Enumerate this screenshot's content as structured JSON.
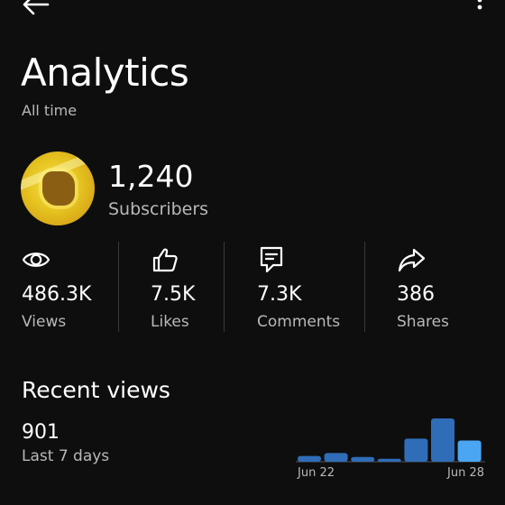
{
  "header": {
    "title": "Analytics",
    "period": "All time"
  },
  "channel": {
    "subscriber_count": "1,240",
    "subscriber_label": "Subscribers"
  },
  "stats": [
    {
      "value": "486.3K",
      "label": "Views"
    },
    {
      "value": "7.5K",
      "label": "Likes"
    },
    {
      "value": "7.3K",
      "label": "Comments"
    },
    {
      "value": "386",
      "label": "Shares"
    }
  ],
  "recent": {
    "title": "Recent views",
    "value": "901",
    "period_label": "Last 7 days"
  },
  "chart_data": {
    "type": "bar",
    "categories": [
      "",
      "",
      "",
      "",
      "",
      "",
      ""
    ],
    "values": [
      12,
      18,
      10,
      6,
      48,
      90,
      44
    ],
    "tick_labels": [
      "Jun 22",
      "Jun 28"
    ],
    "colors": {
      "past": "#2f6db8",
      "latest": "#4aa6f2"
    }
  },
  "colors": {
    "background": "#0e0e0f",
    "text": "#ffffff",
    "muted": "#b8b8b8",
    "divider": "#3a3a3c"
  },
  "icons": [
    "back-arrow-icon",
    "more-vert-icon",
    "eye-icon",
    "thumbs-up-icon",
    "comment-icon",
    "share-icon"
  ]
}
